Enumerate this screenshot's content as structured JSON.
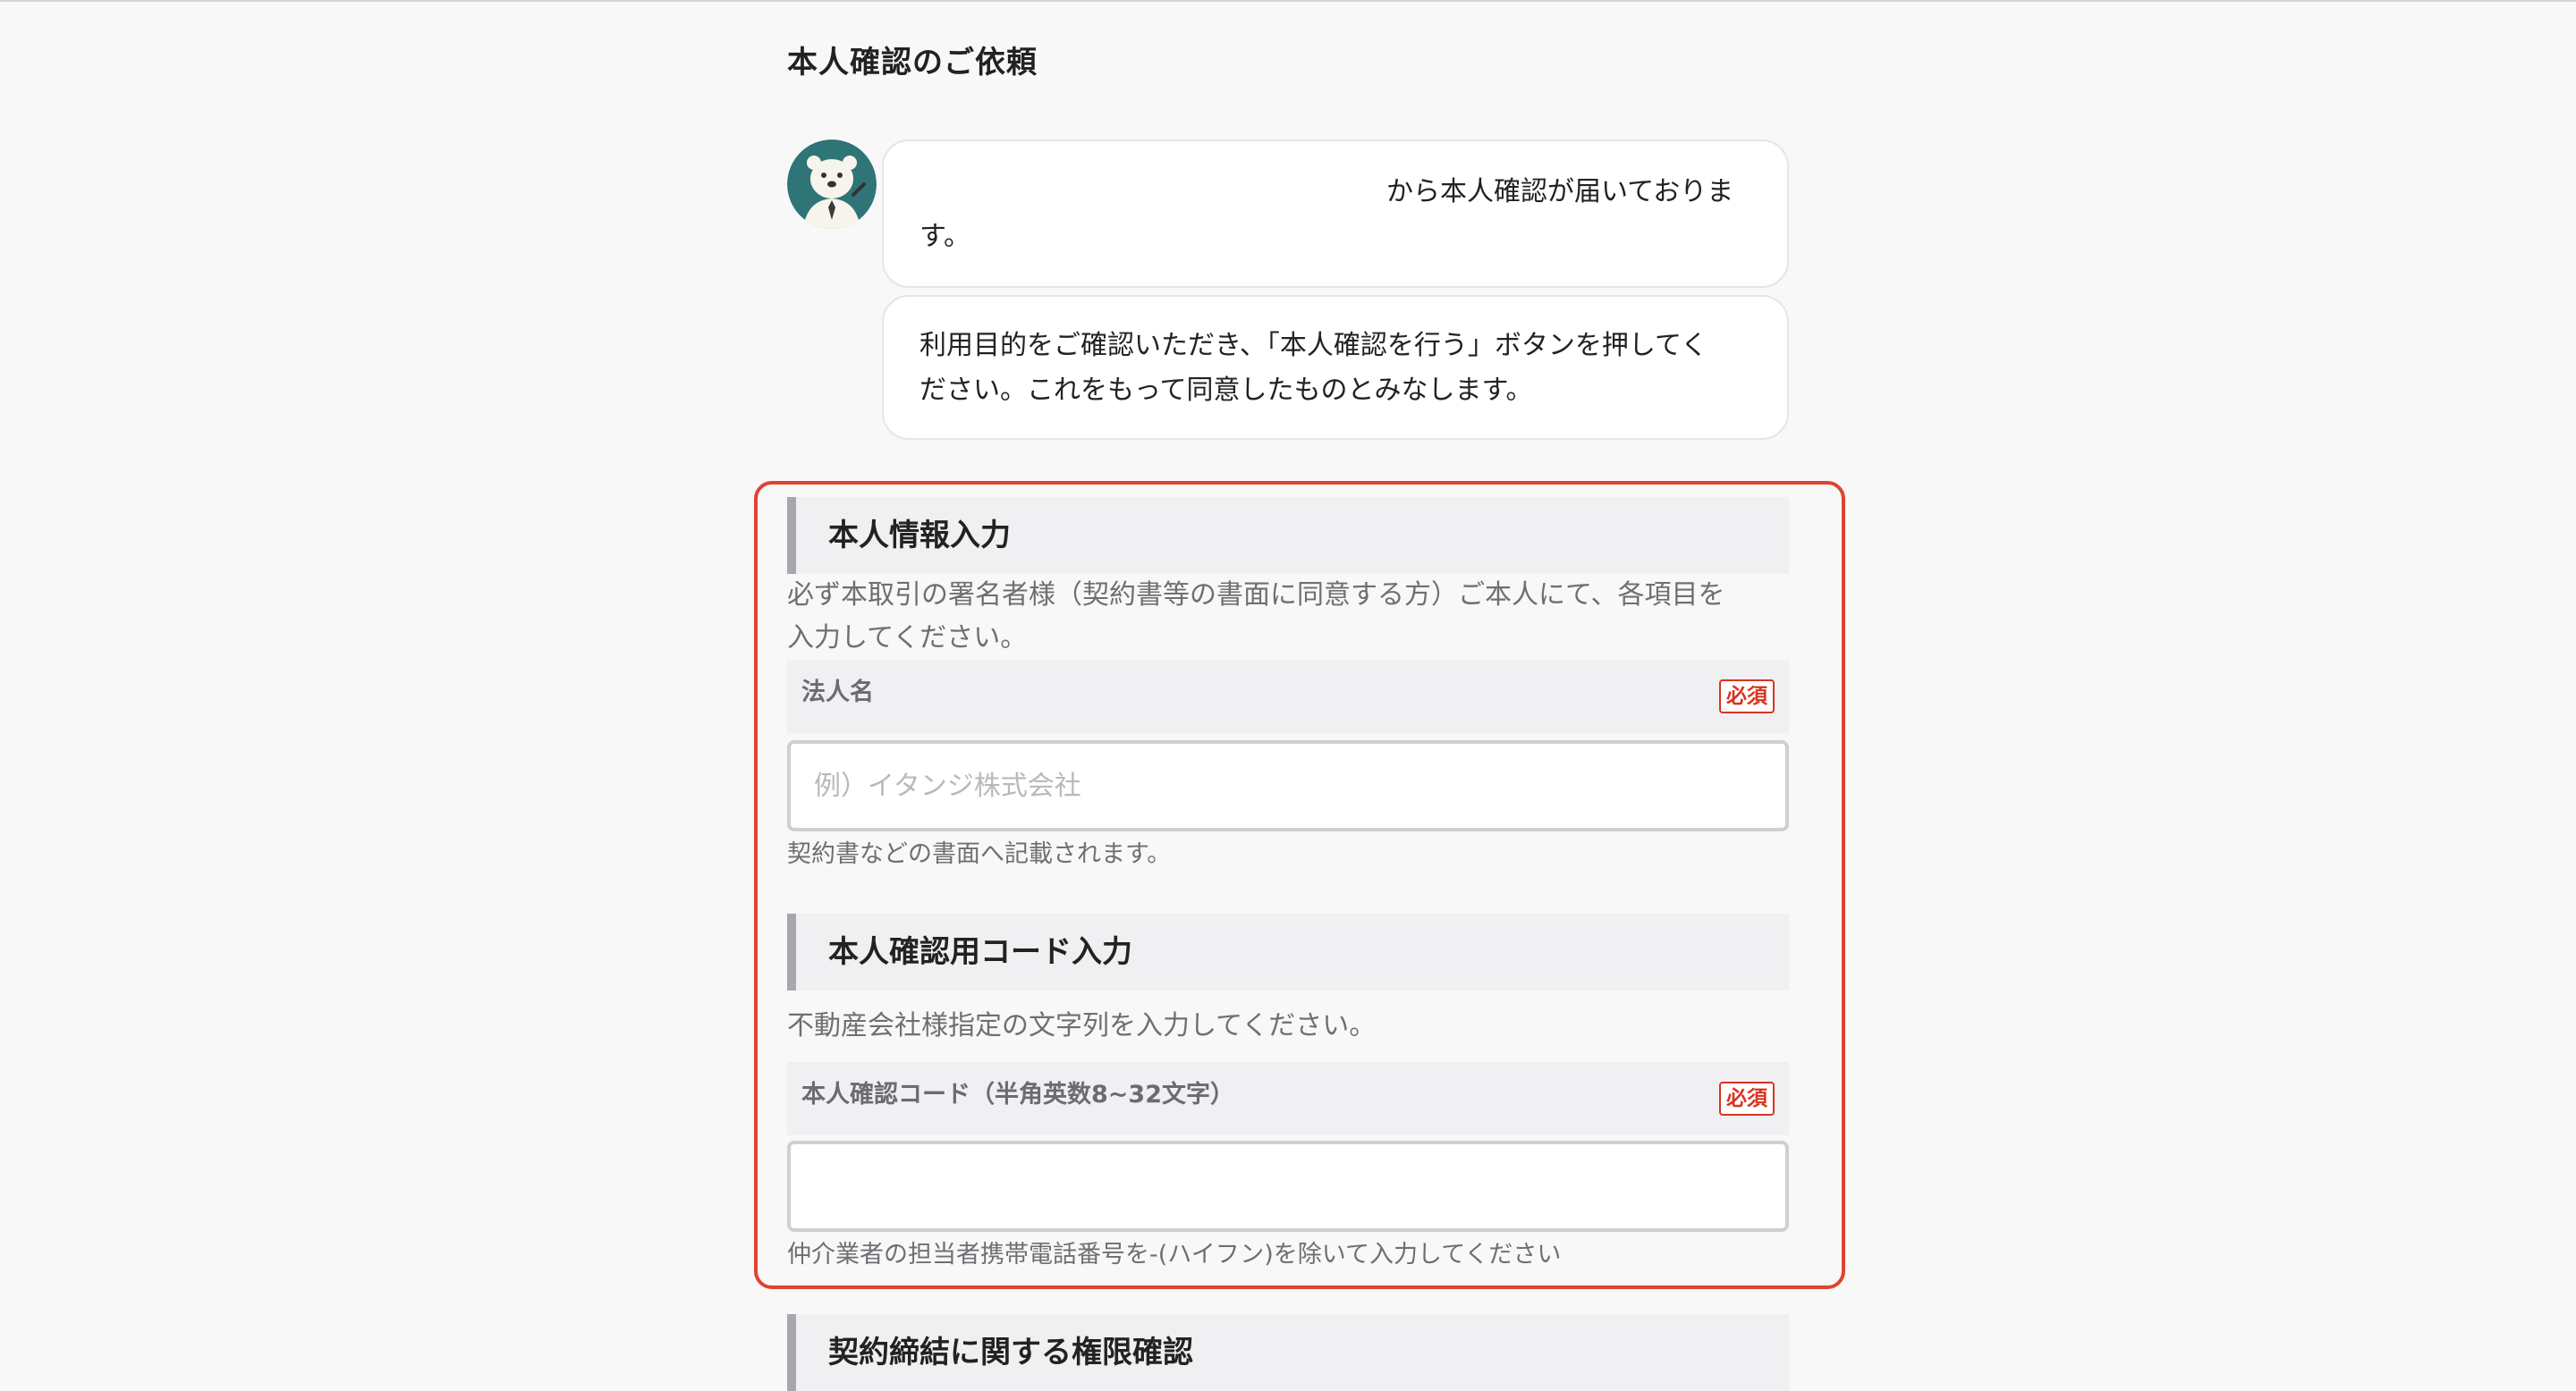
{
  "page": {
    "title": "本人確認のご依頼"
  },
  "messages": {
    "bubble1_line1": "から本人確認が届いておりま",
    "bubble1_line2": "す。",
    "bubble2_line1": "利用目的をご確認いただき、「本人確認を行う」ボタンを押してく",
    "bubble2_line2": "ださい。これをもって同意したものとみなします。"
  },
  "identity_section": {
    "heading": "本人情報入力",
    "description_line1": "必ず本取引の署名者様（契約書等の書面に同意する方）ご本人にて、各項目を",
    "description_line2": "入力してください。",
    "company_field": {
      "label": "法人名",
      "required_badge": "必須",
      "value": "",
      "placeholder": "例）イタンジ株式会社",
      "hint": "契約書などの書面へ記載されます。"
    }
  },
  "code_section": {
    "heading": "本人確認用コード入力",
    "description": "不動産会社様指定の文字列を入力してください。",
    "code_field": {
      "label": "本人確認コード（半角英数8~32文字）",
      "required_badge": "必須",
      "value": "",
      "placeholder": "",
      "hint": "仲介業者の担当者携帯電話番号を-(ハイフン)を除いて入力してください"
    }
  },
  "next_section": {
    "heading": "契約締結に関する権限確認"
  },
  "colors": {
    "highlight_frame": "#e0432f",
    "required": "#d9331f",
    "avatar_bg": "#2f7577",
    "section_bar": "#a8a8ac"
  },
  "icons": {
    "avatar": "polar-bear-mascot-icon"
  }
}
